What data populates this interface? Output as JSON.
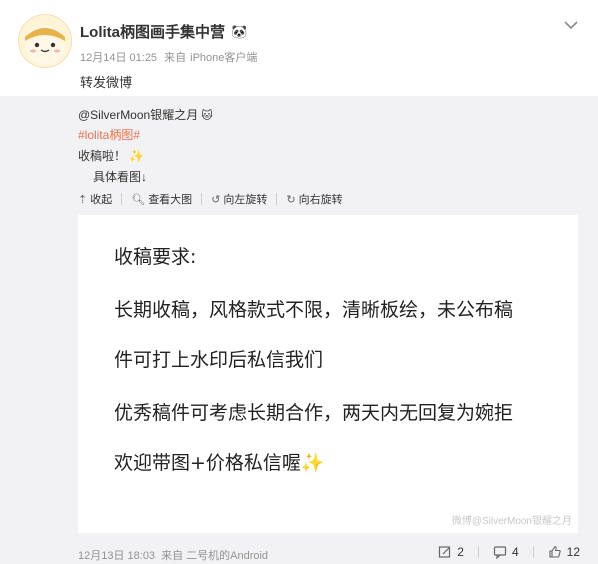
{
  "header": {
    "username": "Lolita柄图画手集中营",
    "badge": "🐼",
    "time": "12月14日 01:25",
    "source_prefix": "来自",
    "source": "iPhone客户端",
    "text": "转发微博"
  },
  "repost": {
    "author": "@SilverMoon银耀之月",
    "author_icon": "🐱",
    "hashtag": "#lolita柄图#",
    "line1": "收稿啦！",
    "line1_icon": "✨",
    "line2": "具体看图↓",
    "toolbar": {
      "collapse": "收起",
      "view_large": "查看大图",
      "rotate_left": "向左旋转",
      "rotate_right": "向右旋转"
    },
    "image": {
      "title": "收稿要求:",
      "lines": [
        "长期收稿，风格款式不限，清晰板绘，未公布稿",
        "件可打上水印后私信我们",
        "优秀稿件可考虑长期合作，两天内无回复为婉拒",
        "欢迎带图+价格私信喔✨"
      ],
      "watermark": "微博@SilverMoon银耀之月"
    },
    "footer": {
      "time": "12月13日 18:03",
      "source_prefix": "来自",
      "source": "二号机的Android",
      "reposts": "2",
      "comments": "4",
      "likes": "12"
    }
  }
}
